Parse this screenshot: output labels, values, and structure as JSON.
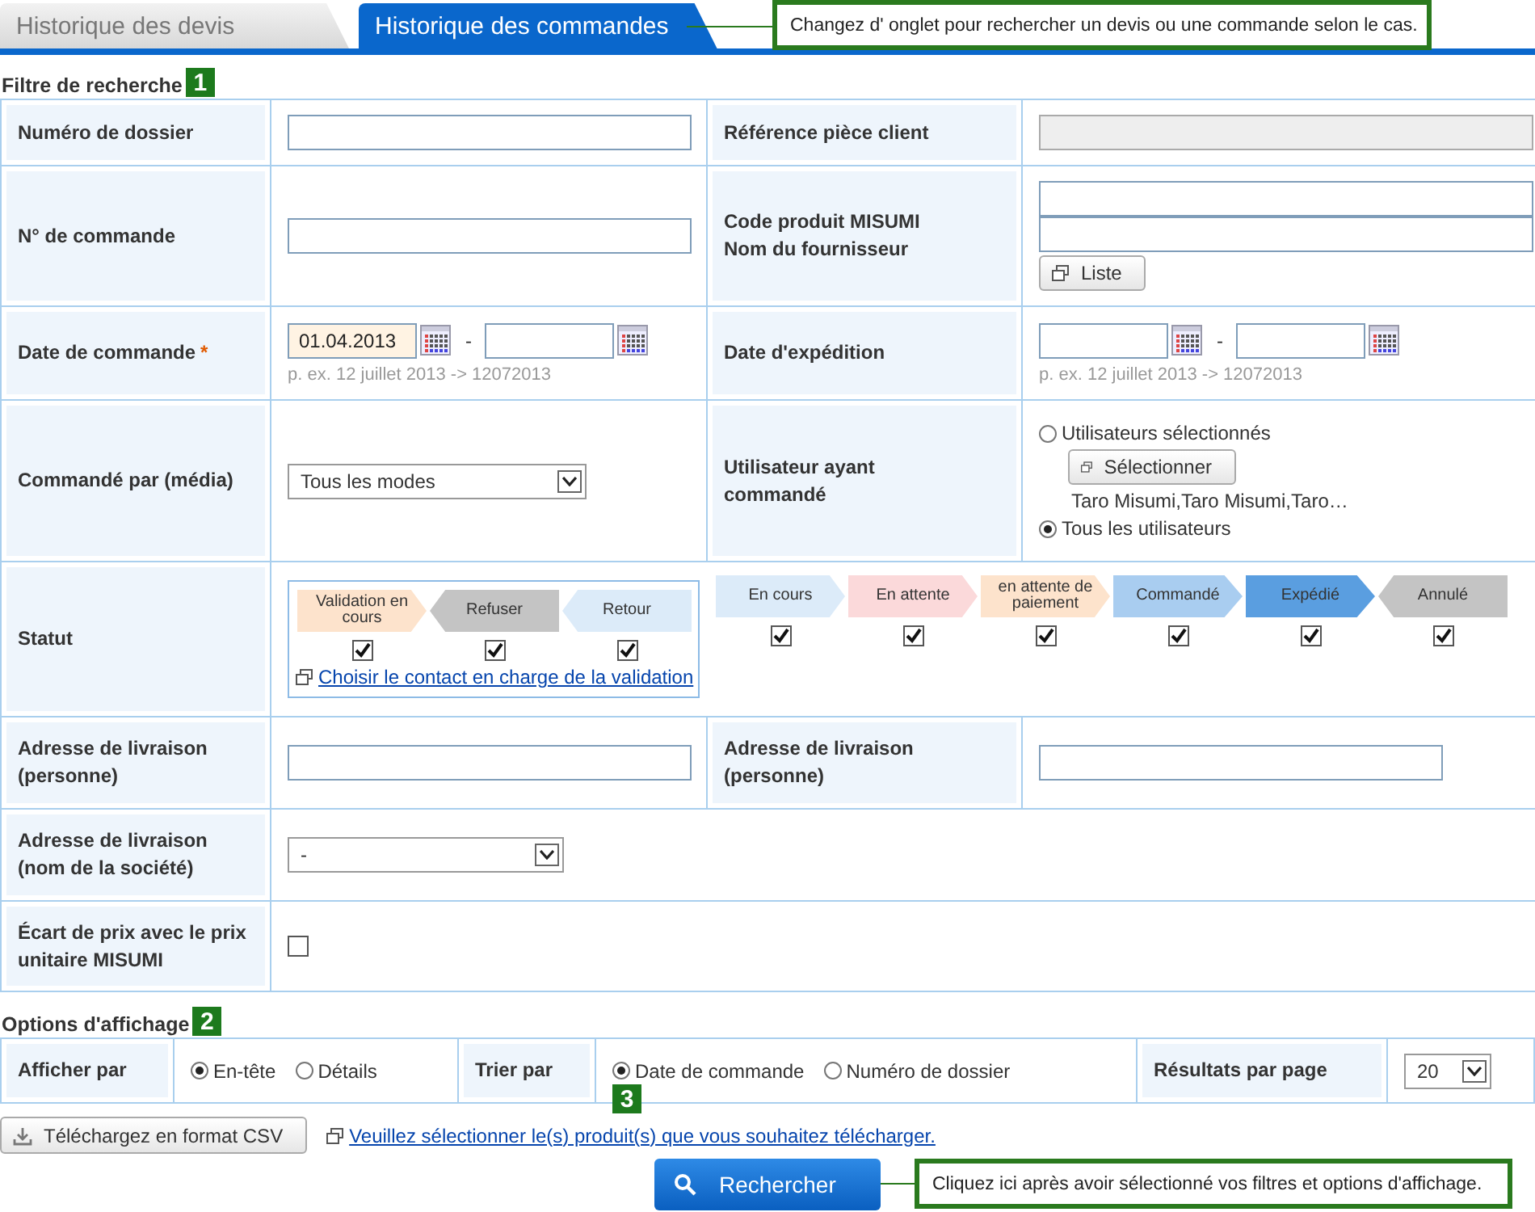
{
  "tabs": [
    {
      "label": "Historique des devis",
      "selected": false
    },
    {
      "label": "Historique des commandes",
      "selected": true
    }
  ],
  "tab_callout": "Changez d' onglet pour rechercher un devis ou une commande selon le cas.",
  "filter": {
    "title": "Filtre de recherche",
    "badge": "1",
    "dossier": {
      "label": "Numéro de dossier"
    },
    "ref_client": {
      "label": "Référence pièce client",
      "disabled": true
    },
    "commande": {
      "label": "N° de commande"
    },
    "code_produit": {
      "label": "Code produit MISUMI",
      "label2": "Nom du fournisseur",
      "button": "Liste"
    },
    "date_commande": {
      "label": "Date de commande",
      "required_mark": "*",
      "from": "01.04.2013",
      "separator": "-",
      "hint": "p. ex. 12 juillet 2013 -> 12072013"
    },
    "date_expedition": {
      "label": "Date d'expédition",
      "separator": "-",
      "hint": "p. ex. 12 juillet 2013 -> 12072013"
    },
    "media": {
      "label": "Commandé par (média)",
      "value": "Tous les modes"
    },
    "utilisateur": {
      "label": "Utilisateur ayant commandé",
      "button": "Sélectionner",
      "names": "Taro Misumi,Taro Misumi,Taro…",
      "options": [
        {
          "label": "Utilisateurs sélectionnés",
          "selected": false
        },
        {
          "label": "Tous les utilisateurs",
          "selected": true
        }
      ]
    },
    "statut": {
      "label": "Statut",
      "link": "Choisir le contact en charge de la validation",
      "validation": [
        {
          "label": "Validation en cours",
          "kind": "forward",
          "color": "#fde3cc",
          "checked": true
        },
        {
          "label": "Refuser",
          "kind": "back",
          "color": "#c4c4c4",
          "checked": true
        },
        {
          "label": "Retour",
          "kind": "back",
          "color": "#dcebf9",
          "checked": true
        }
      ],
      "statuses": [
        {
          "label": "En cours",
          "kind": "forward",
          "color": "#dcebf9",
          "checked": true
        },
        {
          "label": "En attente",
          "kind": "forward",
          "color": "#fbd9da",
          "checked": true
        },
        {
          "label": "en attente de paiement",
          "kind": "forward",
          "color": "#fde3cc",
          "checked": true
        },
        {
          "label": "Commandé",
          "kind": "chevron",
          "color": "#a9cdf0",
          "checked": true
        },
        {
          "label": "Expédié",
          "kind": "chevron",
          "color": "#5a9ee0",
          "checked": true
        },
        {
          "label": "Annulé",
          "kind": "back",
          "color": "#c4c4c4",
          "checked": true
        }
      ]
    },
    "adresse_personne": [
      {
        "label": "Adresse de livraison (personne)"
      },
      {
        "label": "Adresse de livraison (personne)"
      }
    ],
    "societe": {
      "label": "Adresse de livraison (nom de la société)",
      "value": "-"
    },
    "ecart": {
      "label": "Écart de prix avec le prix unitaire MISUMI",
      "checked": false
    }
  },
  "options": {
    "title": "Options d'affichage",
    "badge": "2",
    "afficher": {
      "label": "Afficher par",
      "options": [
        {
          "label": "En-tête",
          "selected": true
        },
        {
          "label": "Détails",
          "selected": false
        }
      ]
    },
    "trier": {
      "label": "Trier par",
      "badge": "3",
      "options": [
        {
          "label": "Date de commande",
          "selected": true
        },
        {
          "label": "Numéro de dossier",
          "selected": false
        }
      ]
    },
    "resultats": {
      "label": "Résultats par page",
      "value": "20"
    }
  },
  "csv_button": "Téléchargez en format CSV",
  "csv_link": "Veuillez sélectionner le(s) produit(s) que vous souhaitez télécharger.",
  "search_button": "Rechercher",
  "search_callout": "Cliquez ici après avoir sélectionné vos filtres et options d'affichage."
}
